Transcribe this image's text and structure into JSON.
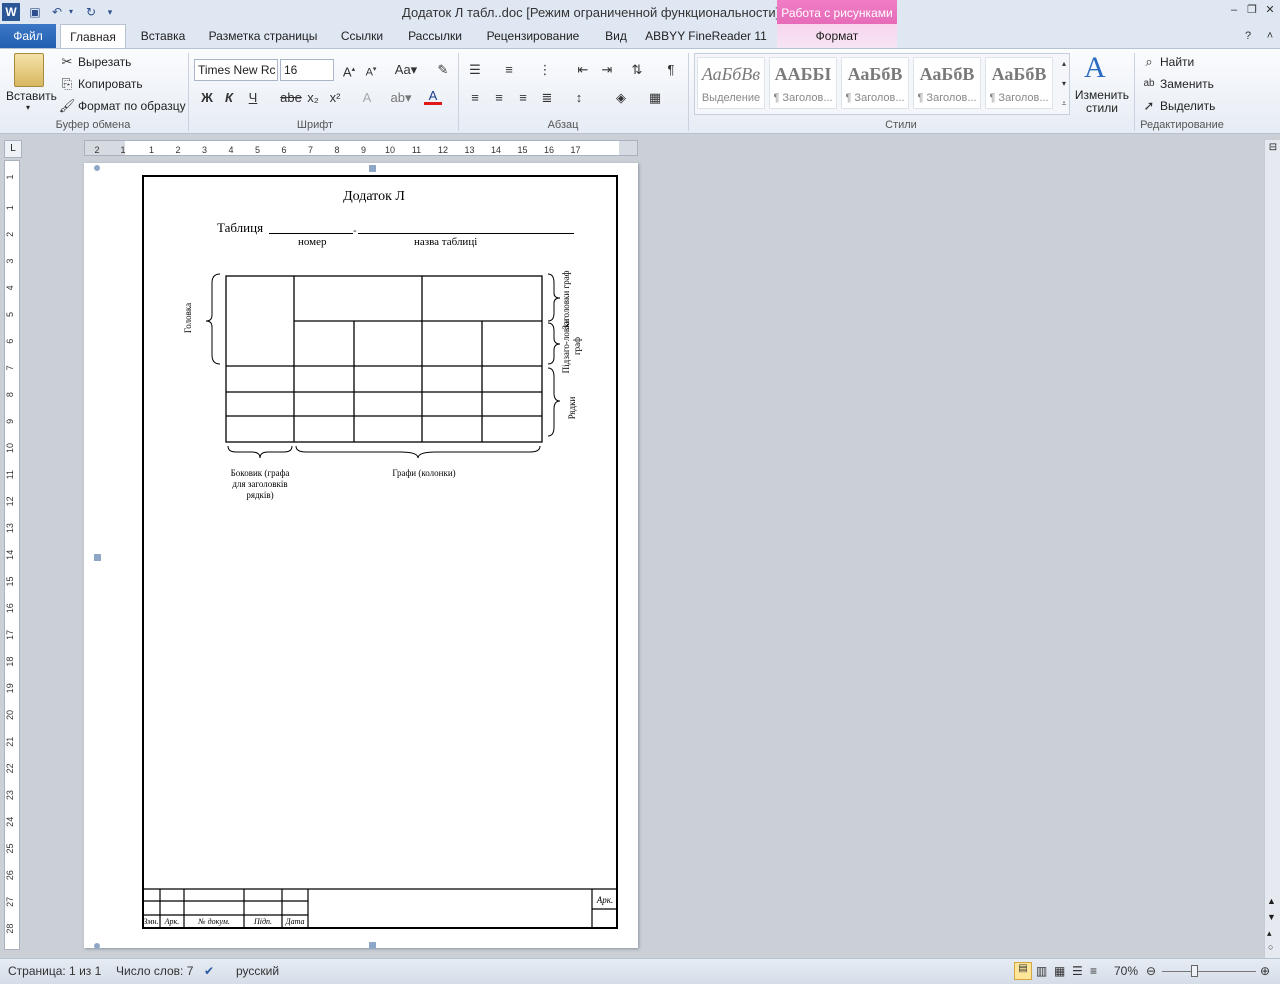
{
  "window": {
    "title": "Додаток Л табл..doc [Режим ограниченной функциональности]  -  Microsoft Word"
  },
  "context_tab": {
    "header": "Работа с рисунками",
    "tab": "Формат"
  },
  "tabs": [
    "Файл",
    "Главная",
    "Вставка",
    "Разметка страницы",
    "Ссылки",
    "Рассылки",
    "Рецензирование",
    "Вид",
    "ABBYY FineReader 11"
  ],
  "clipboard": {
    "paste": "Вставить",
    "cut": "Вырезать",
    "copy": "Копировать",
    "format_painter": "Формат по образцу",
    "group": "Буфер обмена"
  },
  "font": {
    "name": "Times New Rc",
    "size": "16",
    "group": "Шрифт",
    "bold": "Ж",
    "italic": "К",
    "underline": "Ч",
    "strike": "abe"
  },
  "paragraph": {
    "group": "Абзац"
  },
  "styles": {
    "group": "Стили",
    "items": [
      {
        "preview": "АаБбВв",
        "label": "Выделение"
      },
      {
        "preview": "ААББІ",
        "label": "¶ Заголов..."
      },
      {
        "preview": "АаБбВ",
        "label": "¶ Заголов..."
      },
      {
        "preview": "АаБбВ",
        "label": "¶ Заголов..."
      },
      {
        "preview": "АаБбВ",
        "label": "¶ Заголов..."
      }
    ],
    "change": "Изменить стили"
  },
  "editing": {
    "group": "Редактирование",
    "find": "Найти",
    "replace": "Заменить",
    "select": "Выделить"
  },
  "document": {
    "heading": "Додаток Л",
    "table_caption": "Таблиця",
    "label_number": "номер",
    "label_name": "назва таблиці",
    "label_head": "Головка",
    "label_col_headings": "Заголовки граф",
    "label_subheadings": "Підзаго-ловки граф",
    "label_rows": "Рядки",
    "label_stub": "Боковик (графа для заголовків рядків)",
    "label_columns": "Графи (колонки)",
    "stamp": {
      "cols": [
        "Змн.",
        "Арк.",
        "№ докум.",
        "Підп.",
        "Дата"
      ],
      "sheet": "Арк."
    }
  },
  "ruler_h": [
    "2",
    "1",
    "1",
    "2",
    "3",
    "4",
    "5",
    "6",
    "7",
    "8",
    "9",
    "10",
    "11",
    "12",
    "13",
    "14",
    "15",
    "16",
    "17"
  ],
  "ruler_v": [
    "1",
    "1",
    "2",
    "3",
    "4",
    "5",
    "6",
    "7",
    "8",
    "9",
    "10",
    "11",
    "12",
    "13",
    "14",
    "15",
    "16",
    "17",
    "18",
    "19",
    "20",
    "21",
    "22",
    "23",
    "24",
    "25",
    "26",
    "27",
    "28",
    "29"
  ],
  "status": {
    "page": "Страница: 1 из 1",
    "words": "Число слов: 7",
    "lang": "русский",
    "zoom": "70%"
  }
}
